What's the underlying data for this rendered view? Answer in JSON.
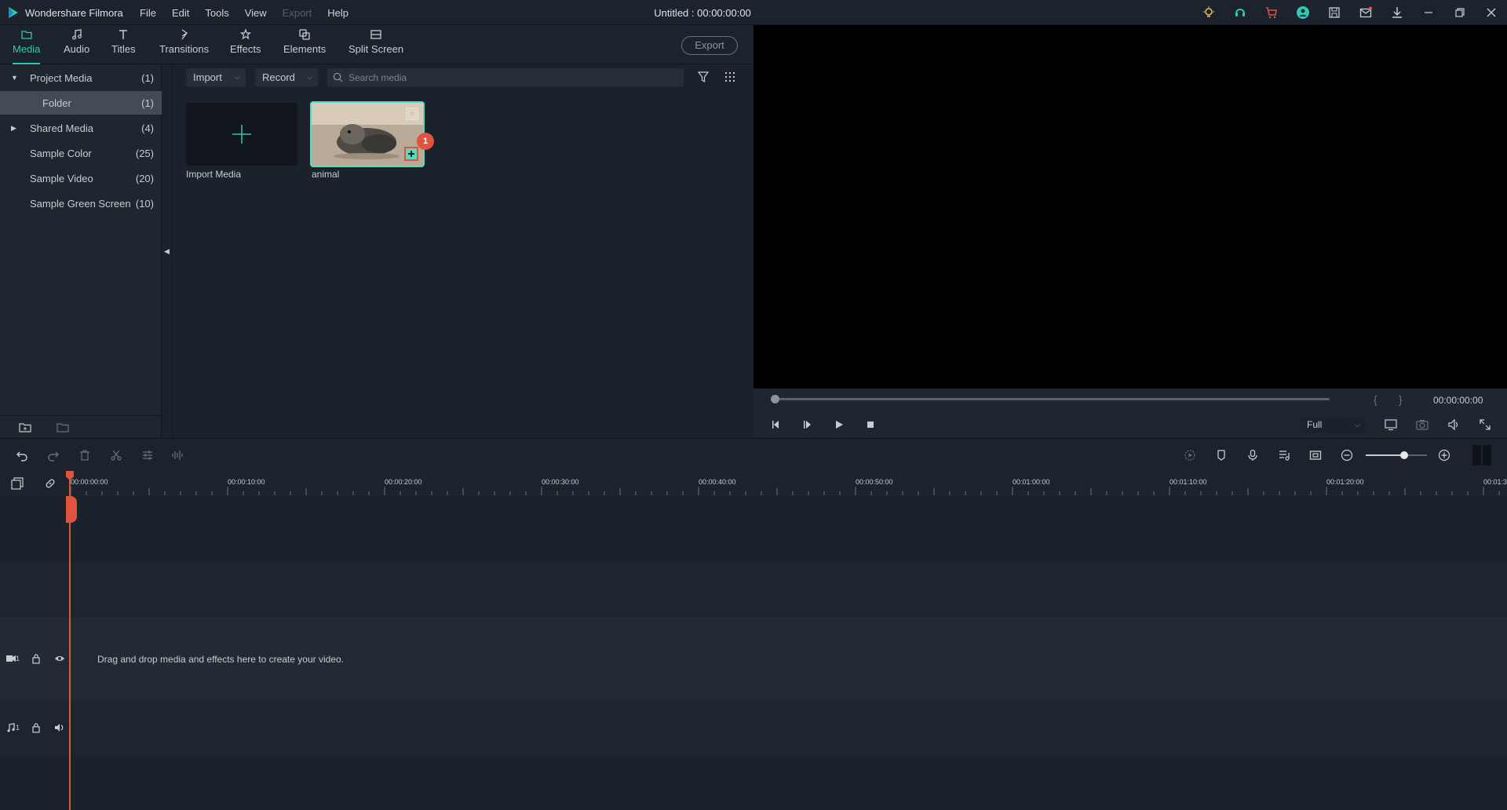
{
  "titlebar": {
    "app_name": "Wondershare Filmora",
    "menus": [
      "File",
      "Edit",
      "Tools",
      "View",
      "Export",
      "Help"
    ],
    "project_title": "Untitled : 00:00:00:00"
  },
  "tabs": [
    "Media",
    "Audio",
    "Titles",
    "Transitions",
    "Effects",
    "Elements",
    "Split Screen"
  ],
  "export_label": "Export",
  "sidebar": {
    "items": [
      {
        "label": "Project Media",
        "count": "(1)"
      },
      {
        "label": "Folder",
        "count": "(1)"
      },
      {
        "label": "Shared Media",
        "count": "(4)"
      },
      {
        "label": "Sample Color",
        "count": "(25)"
      },
      {
        "label": "Sample Video",
        "count": "(20)"
      },
      {
        "label": "Sample Green Screen",
        "count": "(10)"
      }
    ]
  },
  "media_toolbar": {
    "import_label": "Import",
    "record_label": "Record",
    "search_placeholder": "Search media"
  },
  "media_items": [
    {
      "caption": "Import Media"
    },
    {
      "caption": "animal",
      "badge": "1"
    }
  ],
  "preview": {
    "timecode": "00:00:00:00",
    "zoom_option": "Full",
    "progress": 0
  },
  "timeline": {
    "ruler_labels": [
      "00:00:00:00",
      "00:00:10:00",
      "00:00:20:00",
      "00:00:30:00",
      "00:00:40:00",
      "00:00:50:00",
      "00:01:00:00",
      "00:01:10:00",
      "00:01:20:00",
      "00:01:3"
    ],
    "video_track_num": "1",
    "audio_track_num": "1",
    "empty_hint": "Drag and drop media and effects here to create your video."
  },
  "colors": {
    "accent": "#2ec9b4",
    "playhead": "#e0533f",
    "background": "#1b222b"
  }
}
